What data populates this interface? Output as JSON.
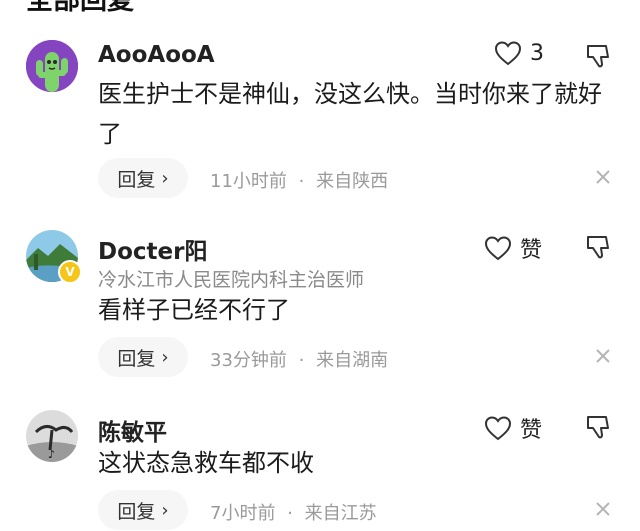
{
  "section_title": "全部回复",
  "comments": [
    {
      "username": "AooAooA",
      "content": "医生护士不是神仙，没这么快。当时你来了就好了",
      "like_count": "3",
      "reply_label": "回复",
      "time": "11小时前",
      "separator": "·",
      "location": "来自陕西"
    },
    {
      "username": "Docter阳",
      "user_title": "冷水江市人民医院内科主治医师",
      "content": "看样子已经不行了",
      "like_label": "赞",
      "reply_label": "回复",
      "time": "33分钟前",
      "separator": "·",
      "location": "来自湖南"
    },
    {
      "username": "陈敏平",
      "content": "这状态急救车都不收",
      "like_label": "赞",
      "reply_label": "回复",
      "time": "7小时前",
      "separator": "·",
      "location": "来自江苏"
    }
  ]
}
